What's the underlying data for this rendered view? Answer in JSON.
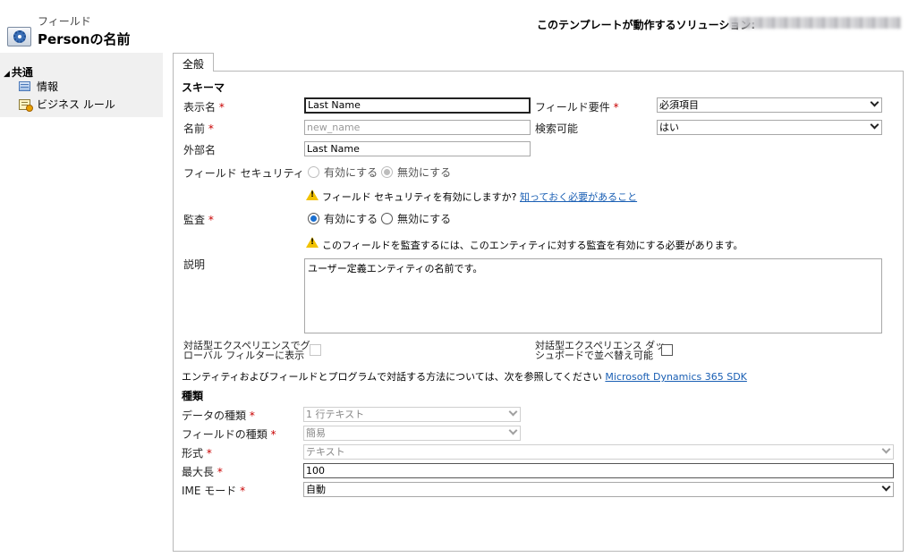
{
  "header": {
    "kind": "フィールド",
    "title": "Personの名前",
    "solution_label": "このテンプレートが動作するソリューション:"
  },
  "nav": {
    "section": "共通",
    "items": [
      {
        "label": "情報",
        "icon": "info-page-icon"
      },
      {
        "label": "ビジネス ルール",
        "icon": "business-rule-icon"
      }
    ]
  },
  "tab": {
    "label": "全般"
  },
  "schema": {
    "title": "スキーマ",
    "display_name": {
      "label": "表示名",
      "value": "Last Name"
    },
    "name": {
      "label": "名前",
      "placeholder": "new_name"
    },
    "external_name": {
      "label": "外部名",
      "value": "Last Name"
    },
    "field_requirement": {
      "label": "フィールド要件",
      "value": "必須項目"
    },
    "searchable": {
      "label": "検索可能",
      "value": "はい"
    },
    "field_security": {
      "label": "フィールド セキュリティ",
      "enable": "有効にする",
      "disable": "無効にする",
      "selected": "disable",
      "warning": "フィールド セキュリティを有効にしますか?",
      "link": "知っておく必要があること"
    },
    "audit": {
      "label": "監査",
      "enable": "有効にする",
      "disable": "無効にする",
      "selected": "enable",
      "warning": "このフィールドを監査するには、このエンティティに対する監査を有効にする必要があります。"
    },
    "description": {
      "label": "説明",
      "value": "ユーザー定義エンティティの名前です。"
    },
    "global_filter": {
      "label_line1": "対話型エクスペリエンスでグ",
      "label_line2": "ローバル フィルターに表示",
      "checked": false
    },
    "sortable": {
      "label_line1": "対話型エクスペリエンス ダッ",
      "label_line2": "シュボードで並べ替え可能",
      "checked": false
    },
    "sdk_text": "エンティティおよびフィールドとプログラムで対話する方法については、次を参照してください",
    "sdk_link": "Microsoft Dynamics 365 SDK"
  },
  "type": {
    "title": "種類",
    "data_type": {
      "label": "データの種類",
      "value": "1 行テキスト"
    },
    "field_type": {
      "label": "フィールドの種類",
      "value": "簡易"
    },
    "format": {
      "label": "形式",
      "value": "テキスト"
    },
    "max_length": {
      "label": "最大長",
      "value": "100"
    },
    "ime_mode": {
      "label": "IME モード",
      "value": "自動"
    }
  },
  "required_mark": "*",
  "colors": {
    "link": "#1a5fb4",
    "required": "#c80000",
    "warning": "#f2c200",
    "radio_selected": "#1a6fd0"
  }
}
